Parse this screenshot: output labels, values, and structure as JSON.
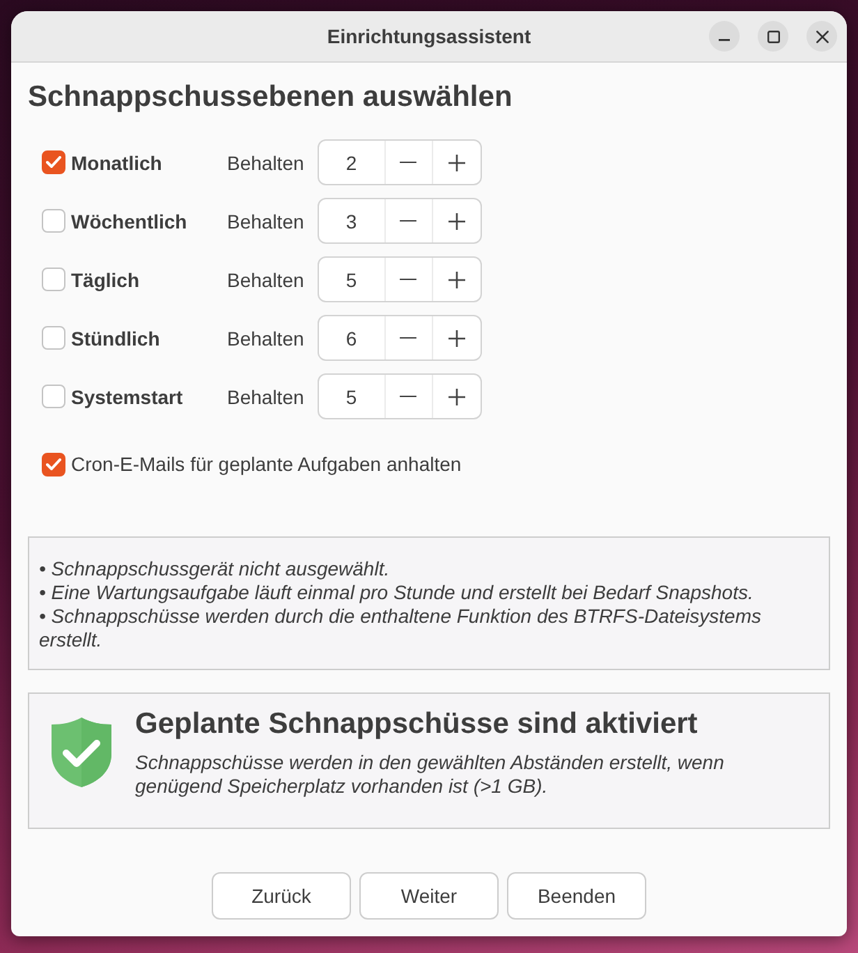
{
  "window": {
    "title": "Einrichtungsassistent"
  },
  "heading": "Schnappschussebenen auswählen",
  "levels": [
    {
      "label": "Monatlich",
      "checked": true,
      "keep_label": "Behalten",
      "value": "2"
    },
    {
      "label": "Wöchentlich",
      "checked": false,
      "keep_label": "Behalten",
      "value": "3"
    },
    {
      "label": "Täglich",
      "checked": false,
      "keep_label": "Behalten",
      "value": "5"
    },
    {
      "label": "Stündlich",
      "checked": false,
      "keep_label": "Behalten",
      "value": "6"
    },
    {
      "label": "Systemstart",
      "checked": false,
      "keep_label": "Behalten",
      "value": "5"
    }
  ],
  "cron_emails": {
    "label": "Cron-E-Mails für geplante Aufgaben anhalten",
    "checked": true
  },
  "notes": [
    "• Schnappschussgerät nicht ausgewählt.",
    "• Eine Wartungsaufgabe läuft einmal pro Stunde und erstellt bei Bedarf Snapshots.",
    "• Schnappschüsse werden durch die enthaltene Funktion des BTRFS-Dateisystems erstellt."
  ],
  "status": {
    "title": "Geplante Schnappschüsse sind aktiviert",
    "message": "Schnappschüsse werden in den gewählten Abständen erstellt, wenn genügend Speicherplatz vorhanden ist (>1 GB)."
  },
  "buttons": [
    "Zurück",
    "Weiter",
    "Beenden"
  ]
}
